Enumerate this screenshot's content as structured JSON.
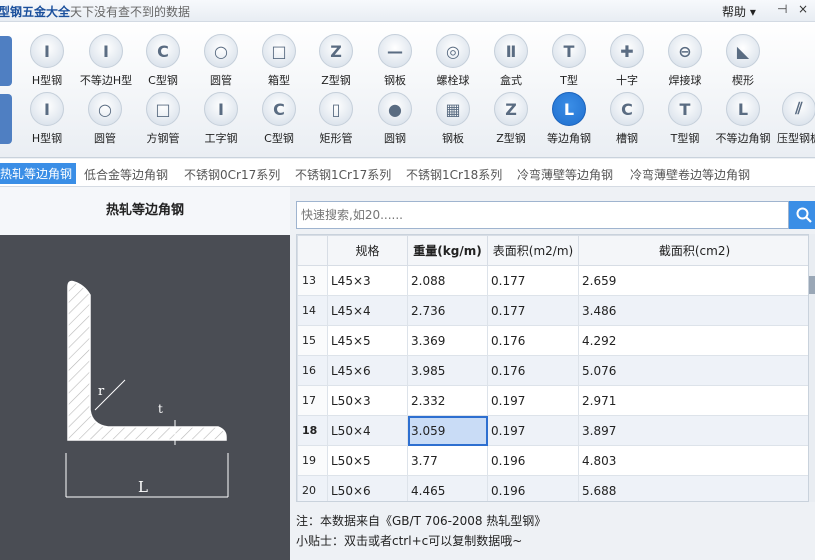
{
  "app": {
    "title": "型钢五金大全",
    "slogan": "天下没有查不到的数据",
    "help": "帮助 ▾",
    "pin": "⊣",
    "close": "×"
  },
  "side_tabs": [
    "型材",
    "管材"
  ],
  "icon_rows": [
    [
      {
        "label": "H型钢",
        "glyph": "I"
      },
      {
        "label": "不等边H型",
        "glyph": "I"
      },
      {
        "label": "C型钢",
        "glyph": "C"
      },
      {
        "label": "圆管",
        "glyph": "○"
      },
      {
        "label": "箱型",
        "glyph": "□"
      },
      {
        "label": "Z型钢",
        "glyph": "Z"
      },
      {
        "label": "钢板",
        "glyph": "—"
      },
      {
        "label": "螺栓球",
        "glyph": "◎"
      },
      {
        "label": "盒式",
        "glyph": "Ⅱ"
      },
      {
        "label": "T型",
        "glyph": "T"
      },
      {
        "label": "十字",
        "glyph": "✚"
      },
      {
        "label": "焊接球",
        "glyph": "⊖"
      },
      {
        "label": "楔形",
        "glyph": "◣"
      }
    ],
    [
      {
        "label": "H型钢",
        "glyph": "I"
      },
      {
        "label": "圆管",
        "glyph": "○"
      },
      {
        "label": "方钢管",
        "glyph": "□"
      },
      {
        "label": "工字钢",
        "glyph": "I"
      },
      {
        "label": "C型钢",
        "glyph": "C"
      },
      {
        "label": "矩形管",
        "glyph": "▯"
      },
      {
        "label": "圆钢",
        "glyph": "●"
      },
      {
        "label": "钢板",
        "glyph": "▦"
      },
      {
        "label": "Z型钢",
        "glyph": "Z"
      },
      {
        "label": "等边角钢",
        "glyph": "L"
      },
      {
        "label": "槽钢",
        "glyph": "C"
      },
      {
        "label": "T型钢",
        "glyph": "T"
      },
      {
        "label": "不等边角钢",
        "glyph": "L"
      },
      {
        "label": "压型钢板",
        "glyph": "⫽"
      }
    ]
  ],
  "sub_tabs": [
    "热轧等边角钢",
    "低合金等边角钢",
    "不锈钢0Cr17系列",
    "不锈钢1Cr17系列",
    "不锈钢1Cr18系列",
    "冷弯薄壁等边角钢",
    "冷弯薄壁卷边等边角钢"
  ],
  "left_panel": {
    "title": "热轧等边角钢",
    "dim_r": "r",
    "dim_t": "t",
    "dim_l": "L"
  },
  "search": {
    "placeholder": "快速搜索,如20......"
  },
  "table": {
    "headers": [
      "规格",
      "重量(kg/m)",
      "表面积(m2/m)",
      "截面积(cm2)"
    ],
    "rows": [
      {
        "n": "13",
        "spec": "L45×3",
        "weight": "2.088",
        "surface": "0.177",
        "area": "2.659"
      },
      {
        "n": "14",
        "spec": "L45×4",
        "weight": "2.736",
        "surface": "0.177",
        "area": "3.486"
      },
      {
        "n": "15",
        "spec": "L45×5",
        "weight": "3.369",
        "surface": "0.176",
        "area": "4.292"
      },
      {
        "n": "16",
        "spec": "L45×6",
        "weight": "3.985",
        "surface": "0.176",
        "area": "5.076"
      },
      {
        "n": "17",
        "spec": "L50×3",
        "weight": "2.332",
        "surface": "0.197",
        "area": "2.971"
      },
      {
        "n": "18",
        "spec": "L50×4",
        "weight": "3.059",
        "surface": "0.197",
        "area": "3.897"
      },
      {
        "n": "19",
        "spec": "L50×5",
        "weight": "3.77",
        "surface": "0.196",
        "area": "4.803"
      },
      {
        "n": "20",
        "spec": "L50×6",
        "weight": "4.465",
        "surface": "0.196",
        "area": "5.688"
      }
    ]
  },
  "notes": {
    "source": "注：本数据来自《GB/T 706-2008 热轧型钢》",
    "tip": "小贴士：双击或者ctrl+c可以复制数据哦~"
  },
  "colors": {
    "accent": "#3a8ee6",
    "diagram_bg": "#4a4d54"
  }
}
